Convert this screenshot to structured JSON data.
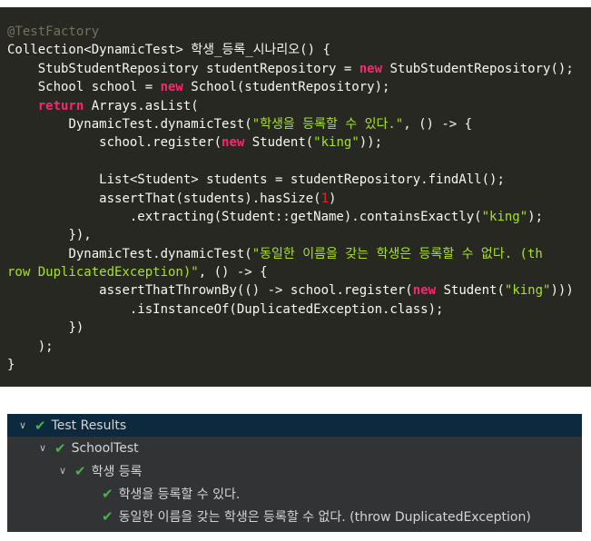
{
  "code": {
    "lines": [
      {
        "indent": "",
        "parts": [
          {
            "t": "@TestFactory",
            "c": "ann"
          }
        ]
      },
      {
        "indent": "",
        "parts": [
          {
            "t": "Collection<DynamicTest> 학생_등록_시나리오() {"
          }
        ]
      },
      {
        "indent": "    ",
        "parts": [
          {
            "t": "StubStudentRepository studentRepository = "
          },
          {
            "t": "new",
            "c": "kw"
          },
          {
            "t": " StubStudentRepository();"
          }
        ]
      },
      {
        "indent": "    ",
        "parts": [
          {
            "t": "School school = "
          },
          {
            "t": "new",
            "c": "kw"
          },
          {
            "t": " School(studentRepository);"
          }
        ]
      },
      {
        "indent": "    ",
        "parts": [
          {
            "t": "return",
            "c": "kw"
          },
          {
            "t": " Arrays.asList("
          }
        ]
      },
      {
        "indent": "        ",
        "parts": [
          {
            "t": "DynamicTest.dynamicTest("
          },
          {
            "t": "\"학생을 등록할 수 있다.\"",
            "c": "str"
          },
          {
            "t": ", () -> {"
          }
        ]
      },
      {
        "indent": "            ",
        "parts": [
          {
            "t": "school.register("
          },
          {
            "t": "new",
            "c": "kw"
          },
          {
            "t": " Student("
          },
          {
            "t": "\"king\"",
            "c": "str"
          },
          {
            "t": "));"
          }
        ]
      },
      {
        "indent": "",
        "parts": [
          {
            "t": ""
          }
        ]
      },
      {
        "indent": "            ",
        "parts": [
          {
            "t": "List<Student> students = studentRepository.findAll();"
          }
        ]
      },
      {
        "indent": "            ",
        "parts": [
          {
            "t": "assertThat(students).hasSize("
          },
          {
            "t": "1",
            "c": "num-red"
          },
          {
            "t": ")"
          }
        ]
      },
      {
        "indent": "                ",
        "parts": [
          {
            "t": ".extracting(Student::getName).containsExactly("
          },
          {
            "t": "\"king\"",
            "c": "str"
          },
          {
            "t": ");"
          }
        ]
      },
      {
        "indent": "        ",
        "parts": [
          {
            "t": "}),"
          }
        ]
      },
      {
        "indent": "        ",
        "parts": [
          {
            "t": "DynamicTest.dynamicTest("
          },
          {
            "t": "\"동일한 이름을 갖는 학생은 등록할 수 없다. (th",
            "c": "str"
          }
        ]
      },
      {
        "indent": "",
        "parts": [
          {
            "t": "row DuplicatedException)\"",
            "c": "str"
          },
          {
            "t": ", () -> {"
          }
        ]
      },
      {
        "indent": "            ",
        "parts": [
          {
            "t": "assertThatThrownBy(() -> school.register("
          },
          {
            "t": "new",
            "c": "kw"
          },
          {
            "t": " Student("
          },
          {
            "t": "\"king\"",
            "c": "str"
          },
          {
            "t": ")))"
          }
        ]
      },
      {
        "indent": "                ",
        "parts": [
          {
            "t": ".isInstanceOf(DuplicatedException.class);"
          }
        ]
      },
      {
        "indent": "        ",
        "parts": [
          {
            "t": "})"
          }
        ]
      },
      {
        "indent": "    ",
        "parts": [
          {
            "t": ");"
          }
        ]
      },
      {
        "indent": "",
        "parts": [
          {
            "t": "}"
          }
        ]
      }
    ]
  },
  "results": {
    "colors": {
      "check": "#4caf50",
      "header_bg": "#0d293e",
      "panel_bg": "#313335"
    },
    "rows": [
      {
        "level": 0,
        "chevron": true,
        "label": "Test Results"
      },
      {
        "level": 1,
        "chevron": true,
        "label": "SchoolTest"
      },
      {
        "level": 2,
        "chevron": true,
        "label": "학생 등록"
      },
      {
        "level": 3,
        "chevron": false,
        "label": "학생을 등록할 수 있다."
      },
      {
        "level": 3,
        "chevron": false,
        "label": "동일한 이름을 갖는 학생은 등록할 수 없다. (throw DuplicatedException)"
      }
    ]
  }
}
